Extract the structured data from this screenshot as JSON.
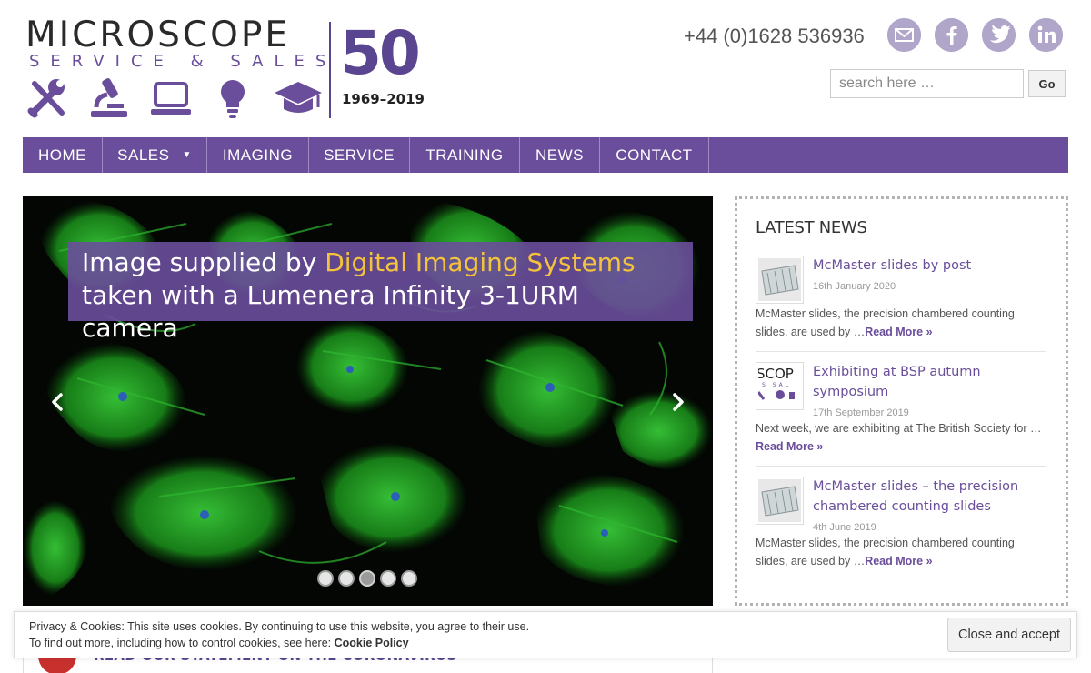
{
  "brand": {
    "title": "MICROSCOPE",
    "subtitle": "SERVICE & SALES",
    "anniversary": "50",
    "years": "1969–2019",
    "icons": [
      "tools-icon",
      "microscope-icon",
      "laptop-icon",
      "lightbulb-icon",
      "graduation-cap-icon"
    ],
    "color": "#6a4e9b"
  },
  "header": {
    "phone": "+44 (0)1628 536936",
    "socials": [
      "email-icon",
      "facebook-icon",
      "twitter-icon",
      "linkedin-icon"
    ],
    "search": {
      "placeholder": "search here …",
      "button": "Go"
    }
  },
  "nav": {
    "items": [
      {
        "label": "HOME"
      },
      {
        "label": "SALES",
        "caret": "▼"
      },
      {
        "label": "IMAGING"
      },
      {
        "label": "SERVICE"
      },
      {
        "label": "TRAINING"
      },
      {
        "label": "NEWS"
      },
      {
        "label": "CONTACT"
      }
    ]
  },
  "slider": {
    "caption_prefix": "Image supplied by ",
    "caption_highlight": "Digital Imaging Systems",
    "caption_line2": "taken with a Lumenera Infinity 3-1URM camera",
    "slide_count": 5,
    "active_slide": 3
  },
  "news": {
    "heading": "LATEST NEWS",
    "items": [
      {
        "title": "McMaster slides by post",
        "date": "16th January 2020",
        "excerpt": "McMaster slides, the precision chambered counting slides, are used by …",
        "read_more": "Read More »"
      },
      {
        "title": "Exhibiting at BSP autumn symposium",
        "date": "17th September 2019",
        "excerpt": "Next week, we are exhibiting at The British Society for …",
        "read_more": "Read More »"
      },
      {
        "title": "McMaster slides – the precision chambered counting slides",
        "date": "4th June 2019",
        "excerpt": "McMaster slides, the precision chambered counting slides, are used by …",
        "read_more": "Read More »"
      }
    ]
  },
  "covid": {
    "label": "READ OUR STATEMENT ON THE CORONAVIRUS"
  },
  "cookie": {
    "line1": "Privacy & Cookies: This site uses cookies. By continuing to use this website, you agree to their use.",
    "line2": "To find out more, including how to control cookies, see here: ",
    "policy_link": "Cookie Policy",
    "button": "Close and accept"
  }
}
